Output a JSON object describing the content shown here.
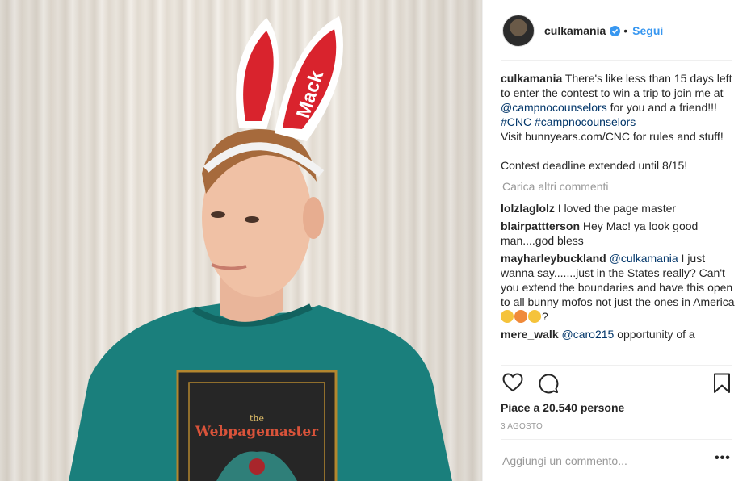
{
  "photo": {
    "ear_text": "Mack",
    "shirt_text_top": "the",
    "shirt_text_main": "Webpagemaster"
  },
  "header": {
    "username": "culkamania",
    "separator": "•",
    "follow_label": "Segui",
    "verified_icon": "verified-badge-icon"
  },
  "caption": {
    "username": "culkamania",
    "text_1": " There's like less than 15 days left to enter the contest to win a trip to join me at ",
    "mention": "@campnocounselors",
    "text_2": " for you and a friend!!! ",
    "hashtag_1": "#CNC",
    "hashtag_2": "#campnocounselors",
    "text_3": "Visit bunnyears.com/CNC for rules and stuff!",
    "text_4": "Contest deadline extended until 8/15!"
  },
  "load_more_label": "Carica altri commenti",
  "comments": [
    {
      "username": "lolzlaglolz",
      "text": " I loved the page master"
    },
    {
      "username": "blairpattterson",
      "text": " Hey Mac! ya look good man....god bless"
    },
    {
      "username": "mayharleybuckland",
      "mention": "@culkamania",
      "text": " I just wanna say.......just in the States really? Can't you extend the boundaries and have this open to all bunny mofos not just the ones in America ",
      "end": "?"
    },
    {
      "username": "mere_walk",
      "mention": "@caro215",
      "text": " opportunity of a"
    }
  ],
  "emojis": [
    {
      "name": "eye-roll-emoji-icon",
      "color": "#f5c33b"
    },
    {
      "name": "hot-face-emoji-icon",
      "color": "#f08a3a"
    },
    {
      "name": "crying-emoji-icon",
      "color": "#f5c33b"
    }
  ],
  "actions": {
    "like_icon": "heart-icon",
    "comment_icon": "comment-icon",
    "save_icon": "bookmark-icon"
  },
  "likes_text": "Piace a 20.540 persone",
  "date_text": "3 AGOSTO",
  "add_comment_placeholder": "Aggiungi un commento...",
  "more_label": "•••",
  "colors": {
    "accent": "#3897f0",
    "link": "#003569",
    "muted": "#999999",
    "text": "#262626",
    "shirt": "#1a7f7c",
    "ears": "#d9232d"
  }
}
